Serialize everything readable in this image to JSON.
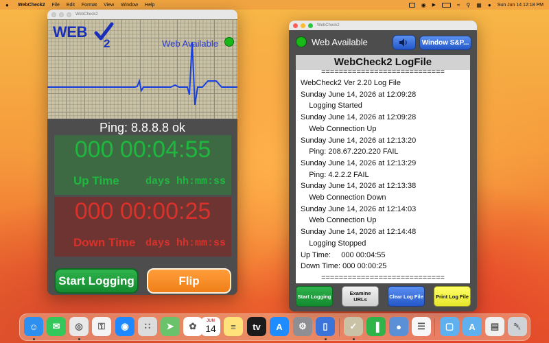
{
  "menubar": {
    "app_name": "WebCheck2",
    "items": [
      "File",
      "Edit",
      "Format",
      "View",
      "Window",
      "Help"
    ],
    "clock": "Sun Jun 14  12:18 PM"
  },
  "monitor_window": {
    "title": "WebCheck2",
    "logo_text": "WEB",
    "logo_sub": "2",
    "web_status": "Web Available",
    "ping": "Ping: 8.8.8.8 ok",
    "up_time": "000 00:04:55",
    "up_label": "Up Time",
    "down_time": "000 00:00:25",
    "down_label": "Down Time",
    "time_format": "days hh:mm:ss",
    "start_button": "Start Logging",
    "flip_button": "Flip"
  },
  "log_window": {
    "title": "WebCheck2",
    "web_status": "Web Available",
    "window_sp_button": "Window S&P...",
    "log_title": "WebCheck2 LogFile",
    "separator": "============================",
    "lines": [
      "WebCheck2 Ver 2.20 Log File",
      "Sunday June 14, 2026 at 12:09:28",
      "    Logging Started",
      "Sunday June 14, 2026 at 12:09:28",
      "    Web Connection Up",
      "Sunday June 14, 2026 at 12:13:20",
      "    Ping: 208.67.220.220 FAIL",
      "Sunday June 14, 2026 at 12:13:29",
      "    Ping: 4.2.2.2 FAIL",
      "Sunday June 14, 2026 at 12:13:38",
      "    Web Connection Down",
      "Sunday June 14, 2026 at 12:14:03",
      "    Web Connection Up",
      "Sunday June 14, 2026 at 12:14:48",
      "    Logging Stopped",
      "Up Time:     000 00:04:55",
      "Down Time: 000 00:00:25"
    ],
    "buttons": {
      "start": "Start Logging",
      "examine": "Examine URLs",
      "clear": "Clear Log File",
      "print": "Print Log File"
    }
  },
  "dock": {
    "apps": [
      {
        "name": "Finder",
        "icon": "finder-icon",
        "color": "#2d8ff0"
      },
      {
        "name": "Messages",
        "icon": "messages-icon",
        "color": "#34c759"
      },
      {
        "name": "Chrome",
        "icon": "chrome-icon",
        "color": "#e9e9e9"
      },
      {
        "name": "Password",
        "icon": "password-icon",
        "color": "#f4f4f4"
      },
      {
        "name": "Safari",
        "icon": "safari-icon",
        "color": "#1e88ff"
      },
      {
        "name": "Launchpad",
        "icon": "launchpad-icon",
        "color": "#dcdcdc"
      },
      {
        "name": "Maps",
        "icon": "maps-icon",
        "color": "#6ac26a"
      },
      {
        "name": "Photos",
        "icon": "photos-icon",
        "color": "#ffffff"
      },
      {
        "name": "Calendar",
        "icon": "calendar-icon",
        "color": "#ffffff"
      },
      {
        "name": "Notes",
        "icon": "notes-icon",
        "color": "#ffe27a"
      },
      {
        "name": "TV",
        "icon": "tv-icon",
        "color": "#1b1b1b"
      },
      {
        "name": "App Store",
        "icon": "app-store-icon",
        "color": "#1e8cff"
      },
      {
        "name": "System Settings",
        "icon": "settings-icon",
        "color": "#8e8e93"
      },
      {
        "name": "Simulator",
        "icon": "simulator-icon",
        "color": "#3a73d9"
      },
      {
        "name": "WebCheck2",
        "icon": "webcheck-icon",
        "color": "#c9c2a6"
      },
      {
        "name": "Numbers",
        "icon": "numbers-icon",
        "color": "#2fb44a"
      },
      {
        "name": "Disk Utility",
        "icon": "disk-icon",
        "color": "#5b8fd6"
      },
      {
        "name": "TextEdit",
        "icon": "textedit-icon",
        "color": "#f7f7f7"
      },
      {
        "name": "Folder",
        "icon": "folder-icon",
        "color": "#5eb0ef"
      },
      {
        "name": "Applications",
        "icon": "applications-folder-icon",
        "color": "#5eb0ef"
      },
      {
        "name": "Document",
        "icon": "document-icon",
        "color": "#f0f0f0"
      },
      {
        "name": "Trash",
        "icon": "trash-icon",
        "color": "#cfd3d8"
      }
    ],
    "calendar_month": "JUN",
    "calendar_day": "14"
  },
  "colors": {
    "up_green": "#1fb83f",
    "down_red": "#d8322b",
    "status_green": "#18b818",
    "logo_blue": "#1a2fb8"
  }
}
